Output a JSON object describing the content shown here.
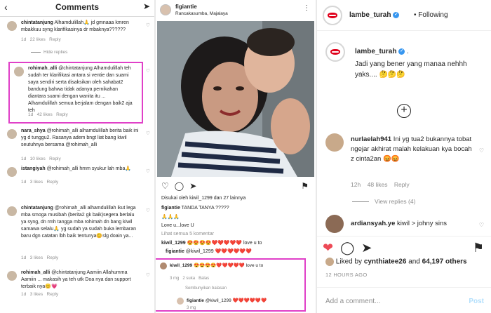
{
  "left": {
    "title": "Comments",
    "comments": [
      {
        "user": "chintatanjung",
        "text": "Alhamdulillah🙏 jd gmnaaa kmren mbakkuu syng klarifikasinya dr mbaknya??????",
        "time": "1d",
        "likes": "22 likes",
        "reply": "Reply"
      },
      {
        "user": "rohimah_alli",
        "text": "@chintatanjung Alhamdulillah teh sudah ter klarifikasi antara si ventie dan suami saya sendiri serta disaksikan oleh sahabat2 bandung bahwa tidak adanya pernikahan diantara suami dengan wanita itu ... Alhamdulillah semua berjalam dengan baik2 aja teh",
        "time": "1d",
        "likes": "42 likes",
        "reply": "Reply"
      },
      {
        "user": "nara_shya",
        "text": "@rohimah_alli alhamdulillah berita baik ini yg d tunggu2. Rasanya adem bngt liat bang kiwil seutuhnya bersama @rohimah_alli",
        "time": "1d",
        "likes": "10 likes",
        "reply": "Reply"
      },
      {
        "user": "istangiyah",
        "text": "@rohimah_alli hmm syukur lah mba🙏",
        "time": "1d",
        "likes": "3 likes",
        "reply": "Reply"
      },
      {
        "user": "chintatanjung",
        "text": "@rohimah_alli alhamdulillah ikut lega mba smoga musibah (berita2 gk baik)segera berlalu ya syng, dn rmh tangga mba rohimah dn bang kiwil samawa selalu🙏 yg sudah ya sudah buka lembaran baru dgn catatan lbh baik tentunya😊slg doain ya...",
        "time": "1d",
        "likes": "3 likes",
        "reply": "Reply"
      },
      {
        "user": "rohimah_alli",
        "text": "@chintatanjung Aamiin Allahumma Aamiin ... makasih ya teh utk Doa nya dan support terbaik nya😊💗",
        "time": "1d",
        "likes": "3 likes",
        "reply": "Reply"
      }
    ],
    "hide_replies": "Hide replies"
  },
  "middle": {
    "user": "figiantie",
    "location": "Rancakasumba, Majalaya",
    "liked_by": "Disukai oleh kiwil_1299 dan 27 lainnya",
    "caption_user": "figiantie",
    "caption": "TANDA TANYA ?????",
    "emojis": "🙏🙏🙏",
    "love_line": "Love u...love U",
    "view_comments": "Lihat semua 5 komentar",
    "c1_user": "kiwil_1299",
    "c1_text": "😍😍😍😍❤️❤️❤️❤️❤️ love u to",
    "c2_user": "figiantie",
    "c2_text": "@kiwil_1299 ❤️❤️❤️❤️❤️❤️",
    "box_user": "kiwil_1299",
    "box_text": "😍😍😍😍❤️❤️❤️❤️❤️ love u to",
    "box_time": "3 mg",
    "box_likes": "2 suka",
    "box_reply": "Balas",
    "hide_replies": "Sembunyikan balasan",
    "box2_user": "figiantie",
    "box2_text": "@kiwil_1299 ❤️❤️❤️❤️❤️❤️",
    "box2_time": "3 mg"
  },
  "right": {
    "user": "lambe_turah",
    "following": "Following",
    "caption": "Jadi yang bener yang manaa nehhh yaks.... 🤔🤔🤔",
    "dot": ".",
    "c1_user": "nurlaelah941",
    "c1_text": "Ini yg tua2 bukannya tobat ngejar akhirat malah kelakuan kya bocah z cinta2an 😡😡",
    "c1_time": "12h",
    "c1_likes": "48 likes",
    "c1_reply": "Reply",
    "view_replies": "View replies (4)",
    "c2_user": "ardiansyah.ye",
    "c2_text": "kiwil > johny sins",
    "liked_by_prefix": "Liked by",
    "liked_by_user": "cynthiatee26",
    "liked_by_and": "and",
    "liked_by_count": "64,197 others",
    "time": "12 HOURS AGO",
    "add_comment": "Add a comment...",
    "post": "Post"
  },
  "colors": {
    "accent_box": "#e040c8",
    "heart_red": "#ed4956",
    "link_blue": "#3897f0"
  }
}
